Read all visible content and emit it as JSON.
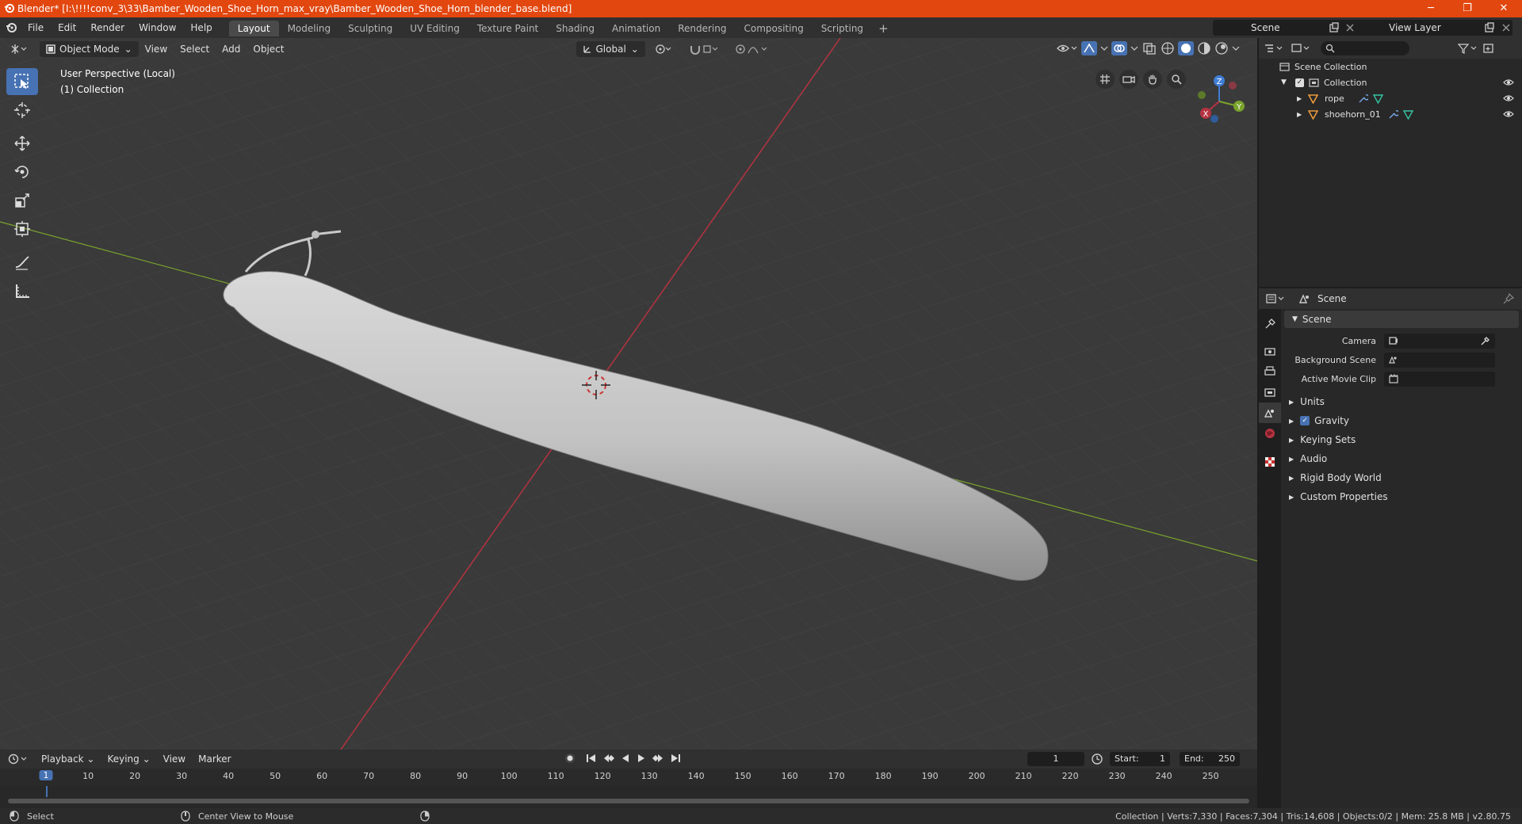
{
  "titlebar": {
    "title": "Blender* [I:\\!!!!conv_3\\33\\Bamber_Wooden_Shoe_Horn_max_vray\\Bamber_Wooden_Shoe_Horn_blender_base.blend]",
    "minimize": "─",
    "maximize": "❐",
    "close": "✕"
  },
  "menu": [
    "File",
    "Edit",
    "Render",
    "Window",
    "Help"
  ],
  "workspaces": [
    "Layout",
    "Modeling",
    "Sculpting",
    "UV Editing",
    "Texture Paint",
    "Shading",
    "Animation",
    "Rendering",
    "Compositing",
    "Scripting"
  ],
  "workspace_add": "+",
  "scene_field": "Scene",
  "view_layer_field": "View Layer",
  "viewport": {
    "mode": "Object Mode",
    "menus": [
      "View",
      "Select",
      "Add",
      "Object"
    ],
    "transform_orientation": "Global",
    "overlay_line1": "User Perspective (Local)",
    "overlay_line2": "(1) Collection",
    "gizmo": {
      "z": "Z",
      "y": "Y",
      "x": "X"
    }
  },
  "outliner": {
    "search_placeholder": "",
    "scene_collection": "Scene Collection",
    "collection": "Collection",
    "items": [
      "rope",
      "shoehorn_01"
    ]
  },
  "properties": {
    "header": "Scene",
    "section_scene": "Scene",
    "camera_label": "Camera",
    "background_scene_label": "Background Scene",
    "active_movie_clip_label": "Active Movie Clip",
    "sections": [
      "Units",
      "Gravity",
      "Keying Sets",
      "Audio",
      "Rigid Body World",
      "Custom Properties"
    ],
    "gravity_checked": true
  },
  "timeline": {
    "menus": [
      "Playback",
      "Keying",
      "View",
      "Marker"
    ],
    "current_frame": "1",
    "start_label": "Start:",
    "start_value": "1",
    "end_label": "End:",
    "end_value": "250",
    "ruler_current": "1",
    "ruler_ticks": [
      "10",
      "20",
      "30",
      "40",
      "50",
      "60",
      "70",
      "80",
      "90",
      "100",
      "110",
      "120",
      "130",
      "140",
      "150",
      "160",
      "170",
      "180",
      "190",
      "200",
      "210",
      "220",
      "230",
      "240",
      "250"
    ]
  },
  "statusbar": {
    "left_action": "Select",
    "middle_action": "Center View to Mouse",
    "stats": "Collection | Verts:7,330 | Faces:7,304 | Tris:14,608 | Objects:0/2 | Mem: 25.8 MB | v2.80.75"
  },
  "colors": {
    "titlebar": "#e2470f",
    "active_blue": "#4772b3",
    "viewport_bg": "#3a3a3a",
    "x_axis": "#b53341",
    "y_axis": "#7aa32c",
    "z_axis": "#3f7ed6"
  }
}
